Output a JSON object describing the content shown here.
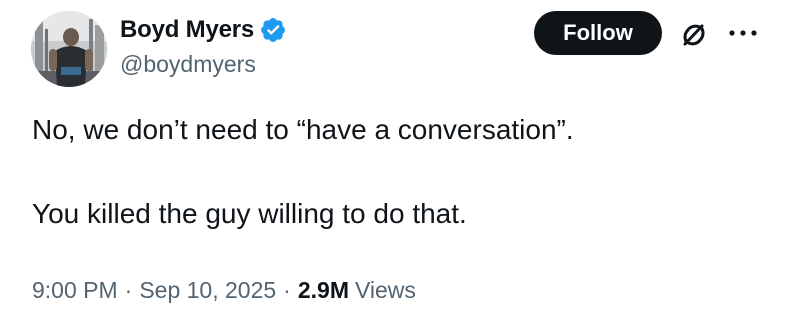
{
  "author": {
    "display_name": "Boyd Myers",
    "handle": "@boydmyers",
    "verified": true
  },
  "actions": {
    "follow_label": "Follow",
    "grok_icon": "grok-icon",
    "more_icon": "more-icon"
  },
  "tweet": {
    "lines": [
      "No, we don’t need to “have a conversation”.",
      "You killed the guy willing to do that."
    ]
  },
  "meta": {
    "time": "9:00 PM",
    "separator": "·",
    "date": "Sep 10, 2025",
    "views_count": "2.9M",
    "views_label": "Views"
  },
  "colors": {
    "text": "#0f1419",
    "secondary": "#536471",
    "verified_badge": "#1d9bf0",
    "follow_bg": "#0f1419"
  }
}
